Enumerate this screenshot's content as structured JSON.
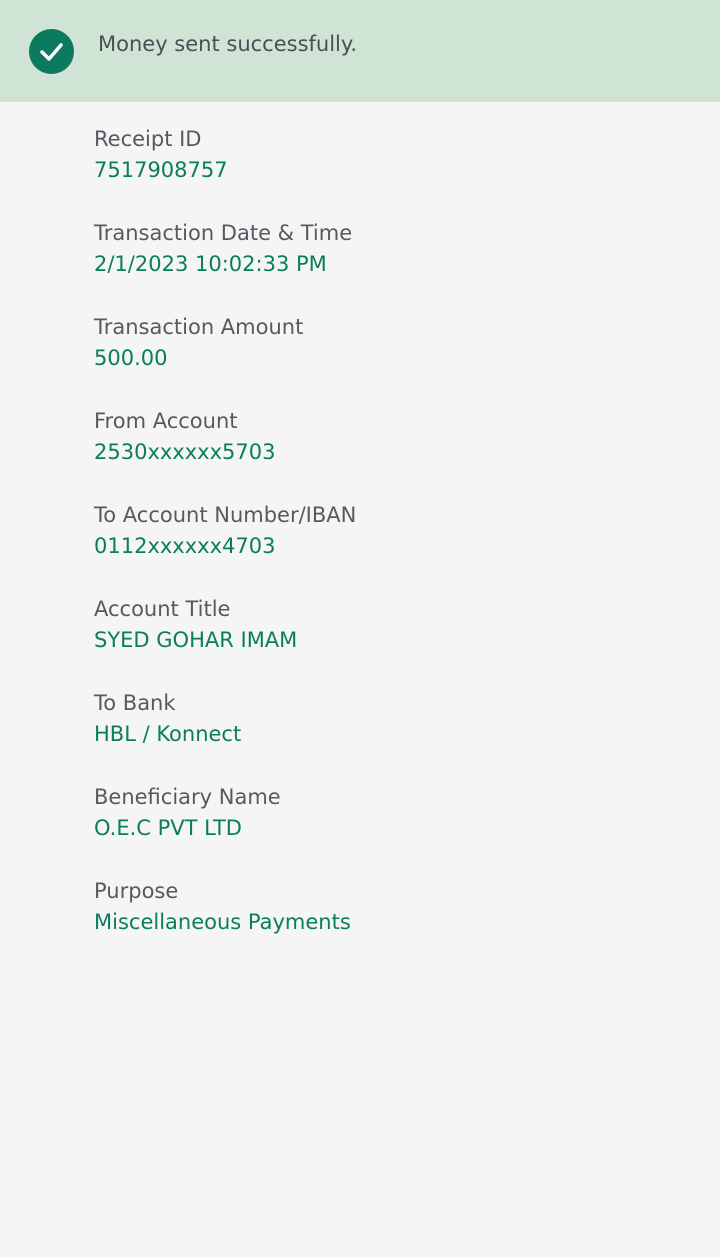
{
  "banner": {
    "icon": "check-circle-icon",
    "message": "Money sent successfully.",
    "background_color": "#cfe4d5",
    "icon_color": "#0b7a5e"
  },
  "details": [
    {
      "label": "Receipt ID",
      "value": "7517908757"
    },
    {
      "label": "Transaction Date & Time",
      "value": "2/1/2023 10:02:33 PM"
    },
    {
      "label": "Transaction Amount",
      "value": "500.00"
    },
    {
      "label": "From Account",
      "value": "2530xxxxxx5703"
    },
    {
      "label": "To Account Number/IBAN",
      "value": "0112xxxxxx4703"
    },
    {
      "label": "Account Title",
      "value": "SYED GOHAR IMAM"
    },
    {
      "label": "To Bank",
      "value": "HBL / Konnect"
    },
    {
      "label": "Beneficiary Name",
      "value": "O.E.C PVT LTD"
    },
    {
      "label": "Purpose",
      "value": "Miscellaneous Payments"
    }
  ],
  "colors": {
    "value_text": "#0a7d5d",
    "label_text": "#555a60",
    "page_background": "#f5f5f5"
  }
}
